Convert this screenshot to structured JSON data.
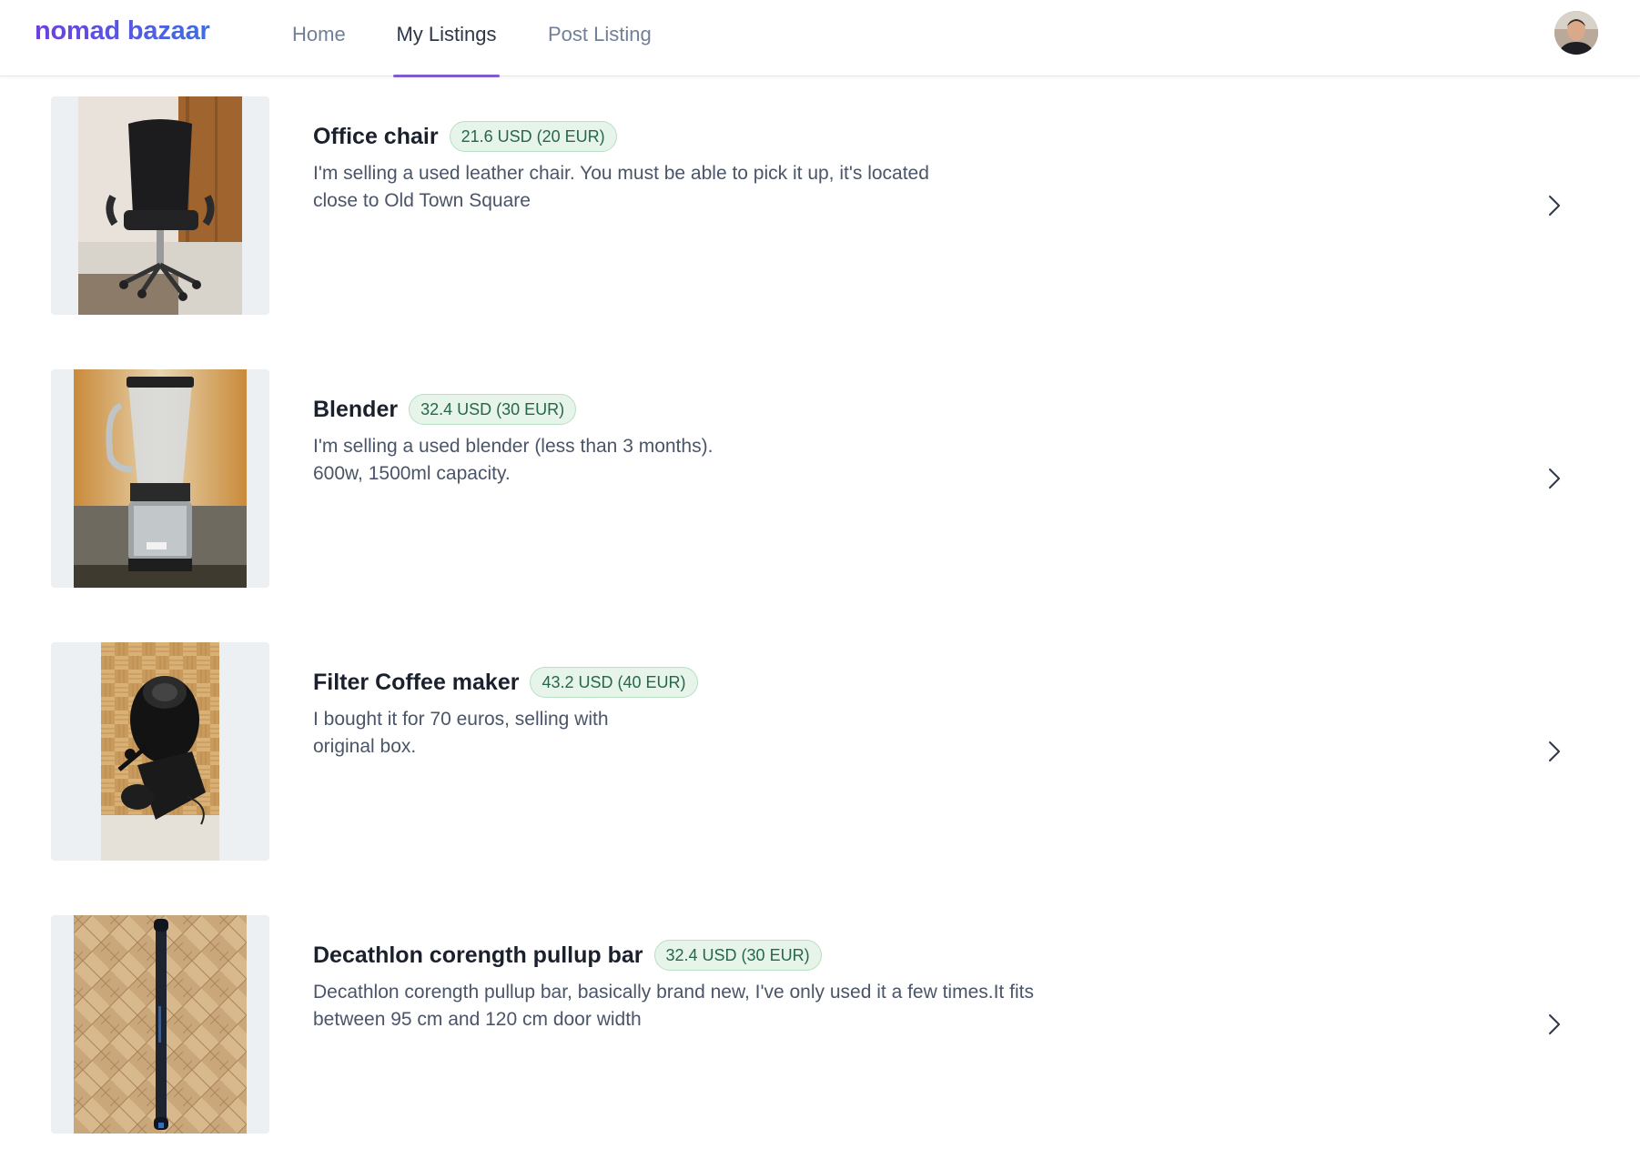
{
  "header": {
    "logo": "nomad bazaar",
    "nav": [
      {
        "label": "Home",
        "active": false
      },
      {
        "label": "My Listings",
        "active": true
      },
      {
        "label": "Post Listing",
        "active": false
      }
    ],
    "avatar_icon": "user-avatar-icon",
    "accent_color": "#805ad5"
  },
  "listings": [
    {
      "title": "Office chair",
      "price": "21.6 USD (20 EUR)",
      "description": "I'm selling a used leather chair. You must be able to pick it up, it's located\nclose to Old Town Square",
      "image_icon": "office-chair-photo"
    },
    {
      "title": "Blender",
      "price": "32.4 USD (30 EUR)",
      "description": "I'm selling a used blender (less than 3 months).\n600w, 1500ml capacity.",
      "image_icon": "blender-photo"
    },
    {
      "title": "Filter Coffee maker",
      "price": "43.2 USD (40 EUR)",
      "description": "I bought it for 70 euros, selling with\noriginal box.",
      "image_icon": "coffee-maker-photo"
    },
    {
      "title": "Decathlon corength pullup bar",
      "price": "32.4 USD (30 EUR)",
      "description": "Decathlon corength pullup bar, basically brand new, I've only used it a few times.It fits\nbetween 95 cm and 120 cm door width",
      "image_icon": "pullup-bar-photo"
    }
  ],
  "colors": {
    "price_text": "#276749",
    "price_bg": "#e6f4ea",
    "thumb_bg": "#edf0f3"
  }
}
